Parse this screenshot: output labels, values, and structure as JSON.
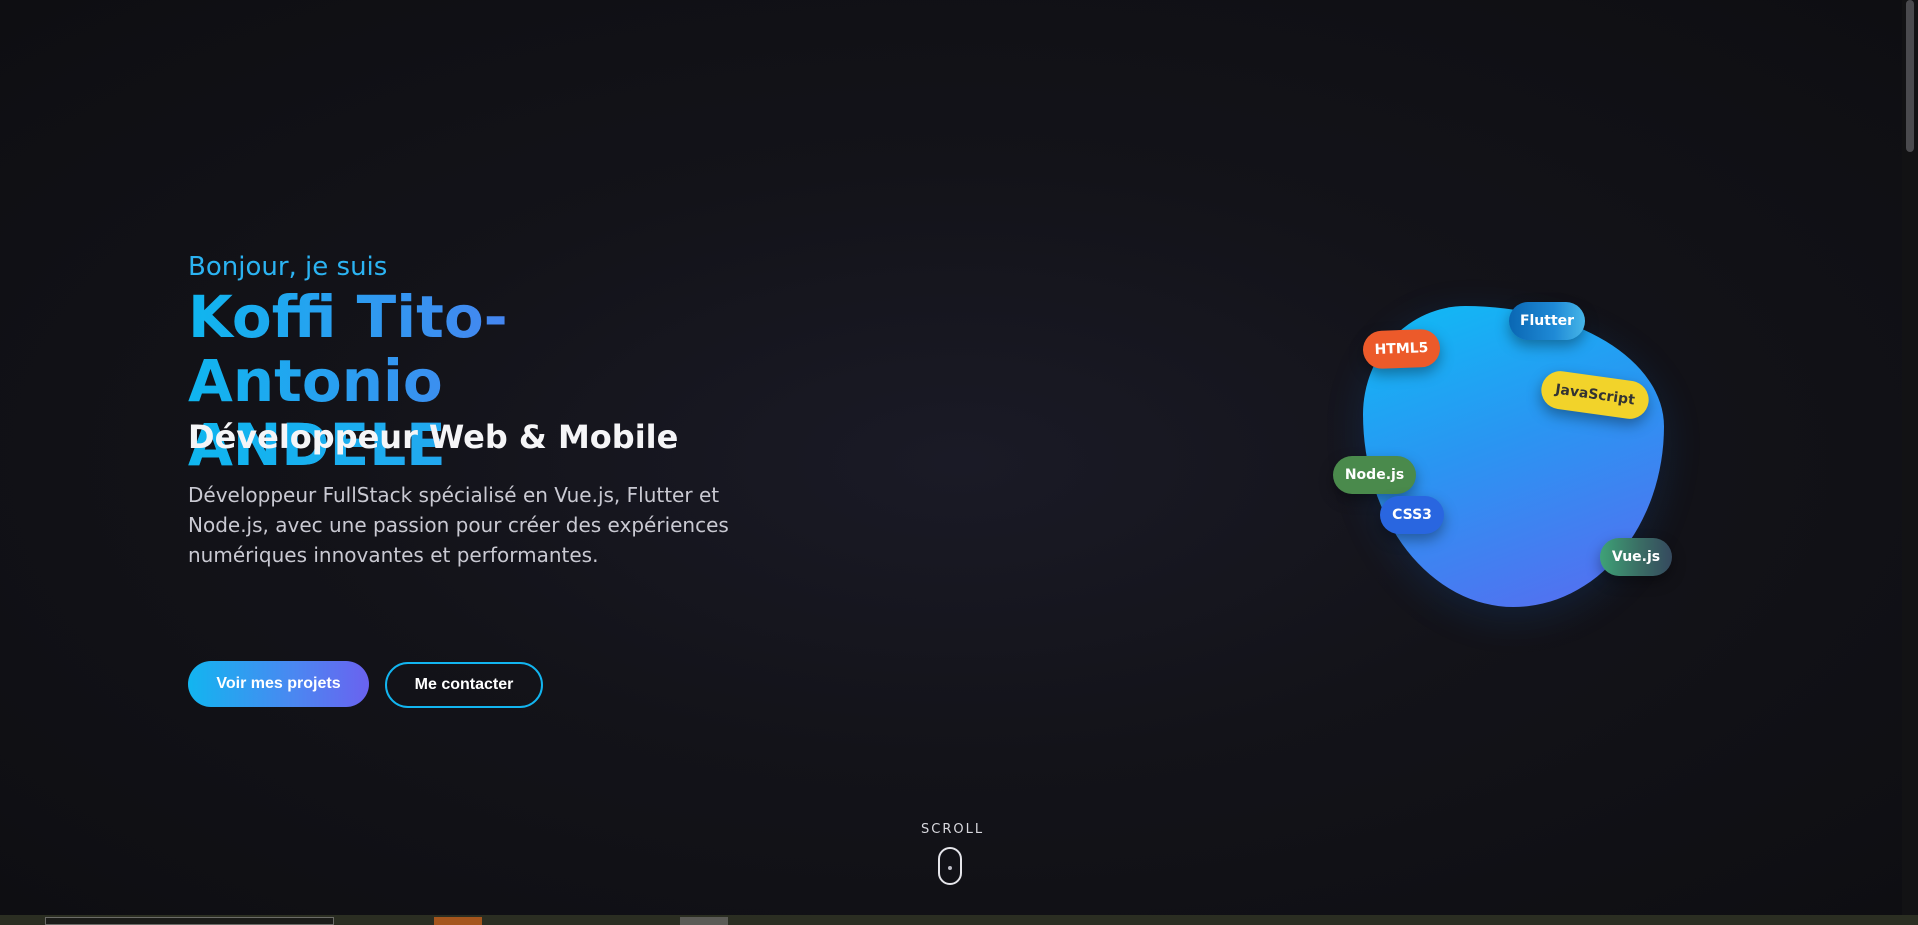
{
  "hero": {
    "greeting": "Bonjour, je suis",
    "name_line1": "Koffi Tito-Antonio",
    "name_line2": "ANDELE",
    "role": "Développeur Web & Mobile",
    "description": "Développeur FullStack spécialisé en Vue.js, Flutter et Node.js, avec une passion pour créer des expériences numériques innovantes et performantes.",
    "primary_button": "Voir mes projets",
    "secondary_button": "Me contacter"
  },
  "tech_tags": {
    "html": "HTML5",
    "flutter": "Flutter",
    "javascript": "JavaScript",
    "node": "Node.js",
    "css": "CSS3",
    "vue": "Vue.js"
  },
  "scroll_indicator": {
    "label": "SCROLL"
  },
  "colors": {
    "background": "#0f0f14",
    "accent_cyan": "#12b5f0",
    "accent_violet": "#6a62ef",
    "text_primary": "#f5f5f7",
    "text_secondary": "#c9c9d2"
  },
  "icons": {
    "scroll": "mouse-icon"
  }
}
